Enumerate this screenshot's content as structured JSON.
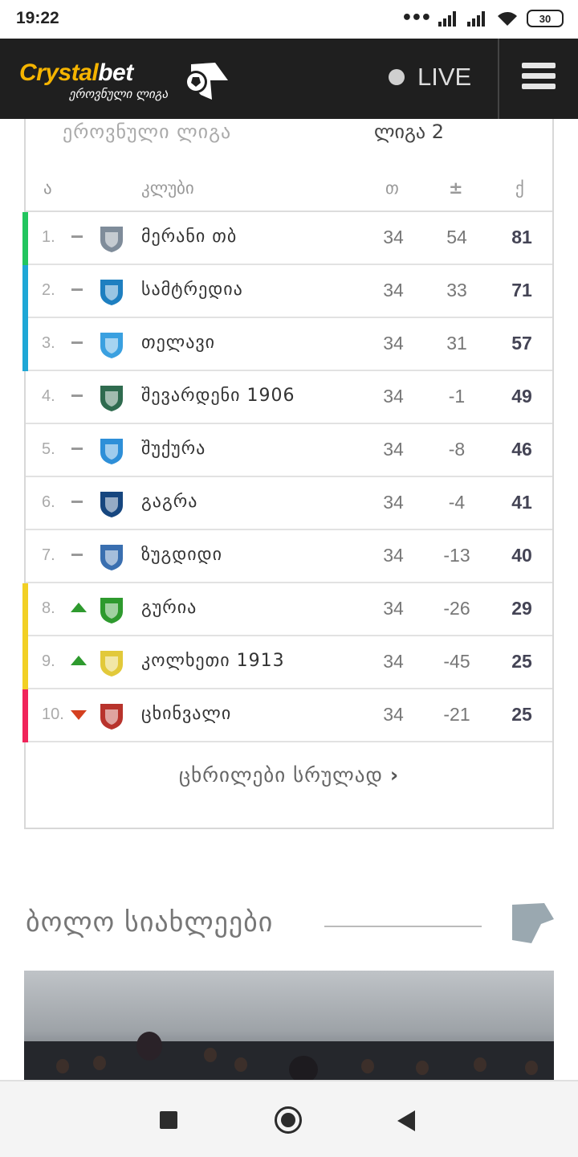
{
  "status_bar": {
    "time": "19:22",
    "battery": "30"
  },
  "header": {
    "brand_part1": "Crystal",
    "brand_part2": "bet",
    "brand_sub": "ეროვნული ლიგა",
    "live_label": "LIVE",
    "colors": {
      "background": "#1f1f1f",
      "brand": "#f5b400"
    }
  },
  "standings": {
    "tabs": [
      "ეროვნული ლიგა",
      "ლიგა 2"
    ],
    "columns": {
      "pos": "ა",
      "club": "კლუბი",
      "played": "თ",
      "gd": "±",
      "points": "ქ"
    },
    "rows": [
      {
        "pos": "1.",
        "trend": "same",
        "club": "მერანი თბ",
        "played": "34",
        "gd": "54",
        "points": "81",
        "zone_color": "#22c55e",
        "crest_icon": "merani-crest-icon"
      },
      {
        "pos": "2.",
        "trend": "same",
        "club": "სამტრედია",
        "played": "34",
        "gd": "33",
        "points": "71",
        "zone_color": "#1ea7d6",
        "crest_icon": "samtredia-crest-icon"
      },
      {
        "pos": "3.",
        "trend": "same",
        "club": "თელავი",
        "played": "34",
        "gd": "31",
        "points": "57",
        "zone_color": "#1ea7d6",
        "crest_icon": "telavi-crest-icon"
      },
      {
        "pos": "4.",
        "trend": "same",
        "club": "შევარდენი 1906",
        "played": "34",
        "gd": "-1",
        "points": "49",
        "zone_color": "",
        "crest_icon": "shevardeni-crest-icon"
      },
      {
        "pos": "5.",
        "trend": "same",
        "club": "შუქურა",
        "played": "34",
        "gd": "-8",
        "points": "46",
        "zone_color": "",
        "crest_icon": "shukura-crest-icon"
      },
      {
        "pos": "6.",
        "trend": "same",
        "club": "გაგრა",
        "played": "34",
        "gd": "-4",
        "points": "41",
        "zone_color": "",
        "crest_icon": "gagra-crest-icon"
      },
      {
        "pos": "7.",
        "trend": "same",
        "club": "ზუგდიდი",
        "played": "34",
        "gd": "-13",
        "points": "40",
        "zone_color": "",
        "crest_icon": "zugdidi-crest-icon"
      },
      {
        "pos": "8.",
        "trend": "up",
        "club": "გურია",
        "played": "34",
        "gd": "-26",
        "points": "29",
        "zone_color": "#f2d024",
        "crest_icon": "guria-crest-icon"
      },
      {
        "pos": "9.",
        "trend": "up",
        "club": "კოლხეთი 1913",
        "played": "34",
        "gd": "-45",
        "points": "25",
        "zone_color": "#f2d024",
        "crest_icon": "kolkheti-crest-icon"
      },
      {
        "pos": "10.",
        "trend": "down",
        "club": "ცხინვალი",
        "played": "34",
        "gd": "-21",
        "points": "25",
        "zone_color": "#f0245a",
        "crest_icon": "tskhinvali-crest-icon"
      }
    ],
    "full_tables_link": "ცხრილები სრულად"
  },
  "news": {
    "title": "ბოლო სიახლეები"
  },
  "nav": {
    "icons": [
      "recents-square-icon",
      "home-circle-icon",
      "back-triangle-icon"
    ]
  }
}
